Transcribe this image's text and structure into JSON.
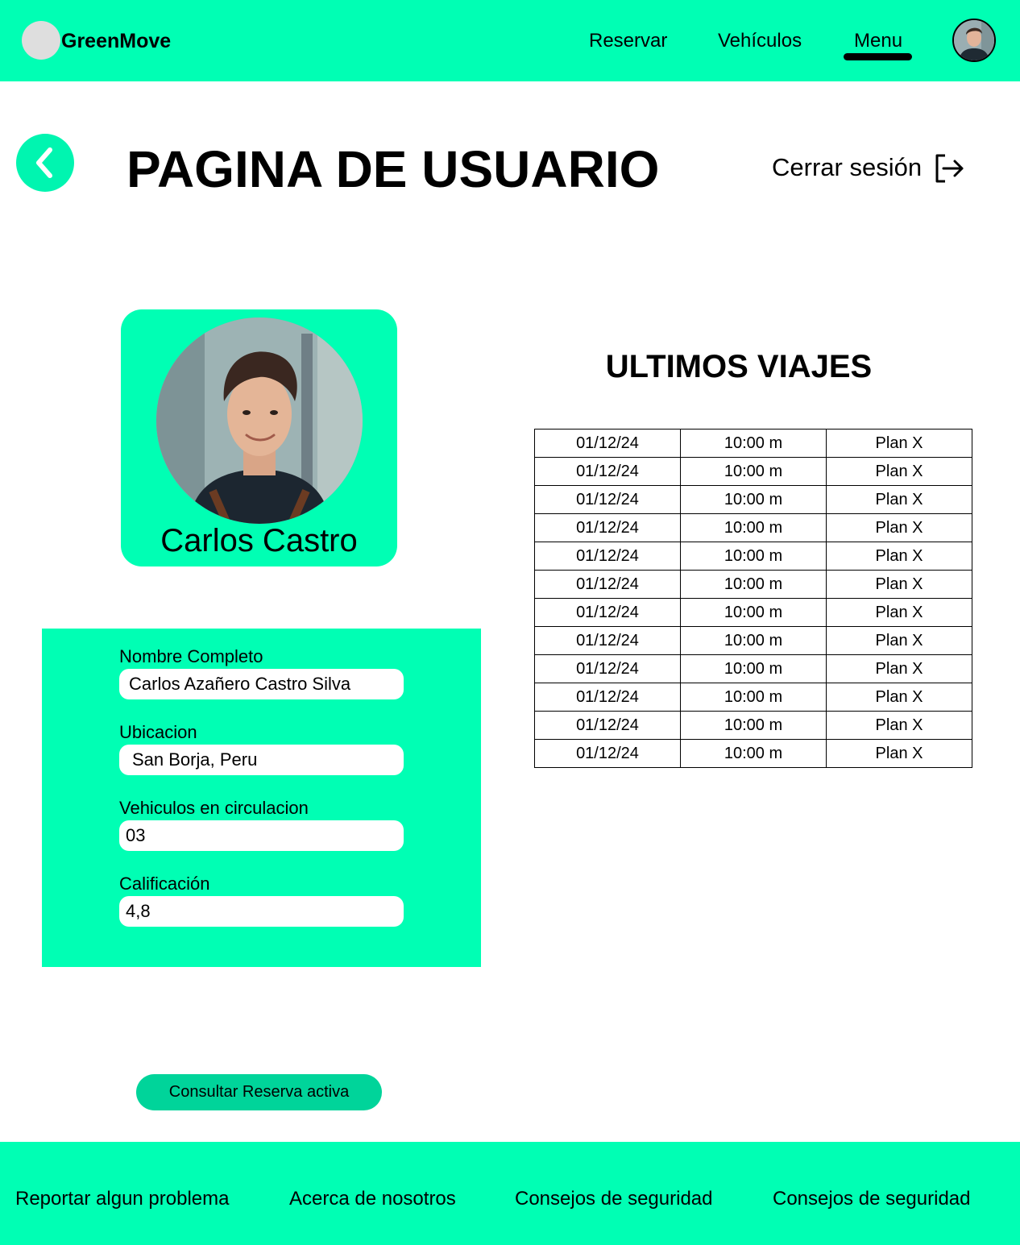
{
  "header": {
    "brand": "GreenMove",
    "nav": [
      "Reservar",
      "Vehículos",
      "Menu"
    ],
    "active_nav": "Menu",
    "accent_color": "#00ffb4"
  },
  "page": {
    "title": "PAGINA DE USUARIO",
    "logout_label": "Cerrar sesión",
    "back_icon": "chevron-left-icon",
    "logout_icon": "logout-icon"
  },
  "profile": {
    "name": "Carlos Castro"
  },
  "details": {
    "fields": [
      {
        "label": "Nombre Completo",
        "value": "Carlos Azañero Castro Silva"
      },
      {
        "label": "Ubicacion",
        "value": "San Borja, Peru"
      },
      {
        "label": "Vehiculos en circulacion",
        "value": "03"
      },
      {
        "label": "Calificación",
        "value": "4,8"
      }
    ]
  },
  "trips": {
    "title": "ULTIMOS VIAJES",
    "rows": [
      [
        "01/12/24",
        "10:00 m",
        "Plan X"
      ],
      [
        "01/12/24",
        "10:00 m",
        "Plan X"
      ],
      [
        "01/12/24",
        "10:00 m",
        "Plan X"
      ],
      [
        "01/12/24",
        "10:00 m",
        "Plan X"
      ],
      [
        "01/12/24",
        "10:00 m",
        "Plan X"
      ],
      [
        "01/12/24",
        "10:00 m",
        "Plan X"
      ],
      [
        "01/12/24",
        "10:00 m",
        "Plan X"
      ],
      [
        "01/12/24",
        "10:00 m",
        "Plan X"
      ],
      [
        "01/12/24",
        "10:00 m",
        "Plan X"
      ],
      [
        "01/12/24",
        "10:00 m",
        "Plan X"
      ],
      [
        "01/12/24",
        "10:00 m",
        "Plan X"
      ],
      [
        "01/12/24",
        "10:00 m",
        "Plan X"
      ]
    ]
  },
  "actions": {
    "active_reservation_label": "Consultar Reserva activa"
  },
  "footer": {
    "links": [
      "Reportar algun problema",
      "Acerca de nosotros",
      "Consejos de seguridad",
      "Consejos de seguridad"
    ]
  }
}
